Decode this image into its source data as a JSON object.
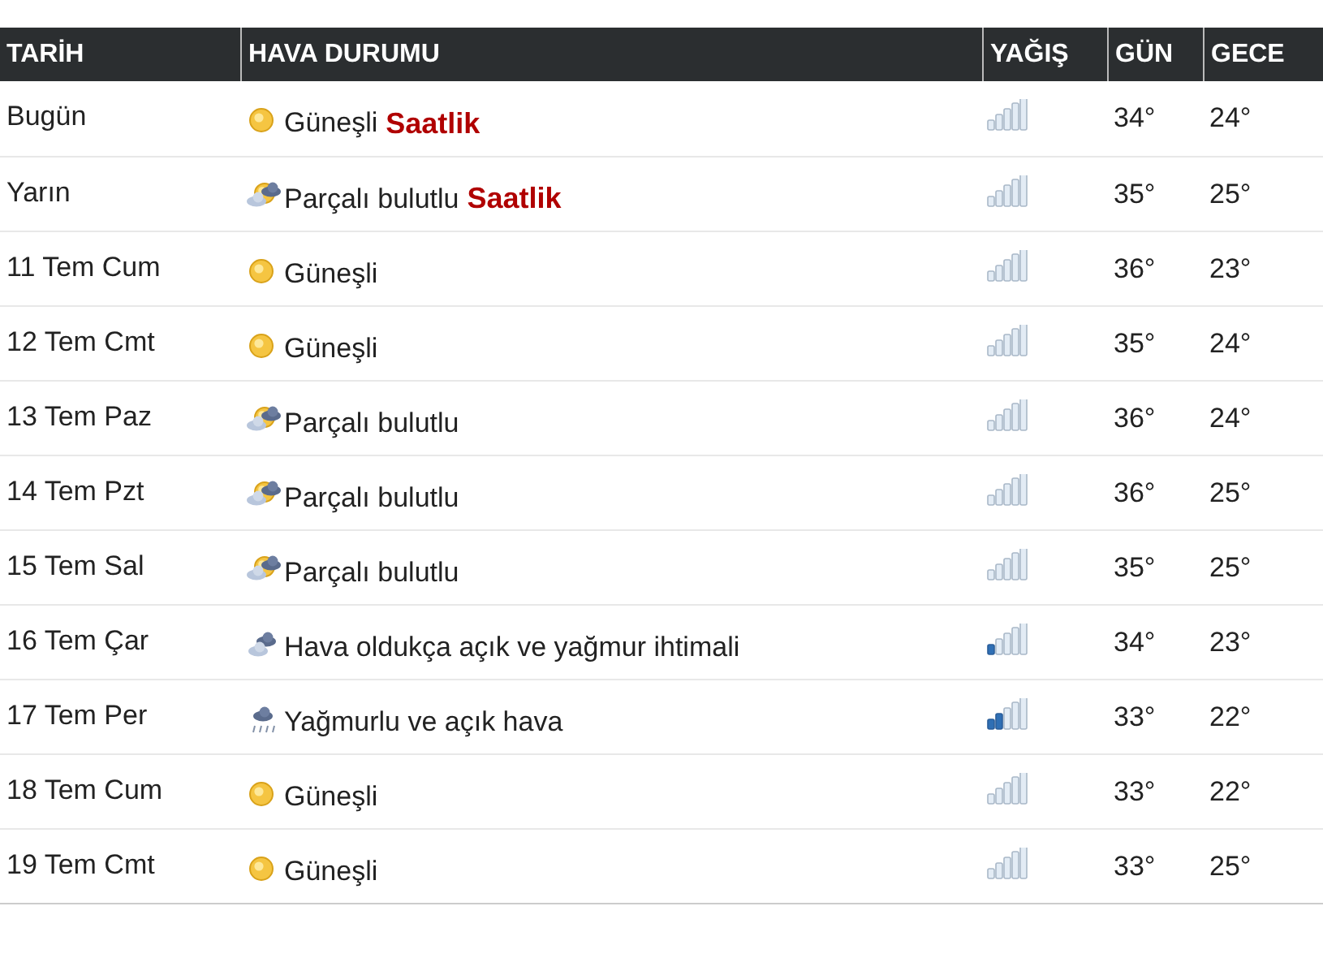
{
  "columns": [
    "TARİH",
    "HAVA DURUMU",
    "YAĞIŞ",
    "GÜN",
    "GECE"
  ],
  "rows": [
    {
      "date": "Bugün",
      "kind": "sunny",
      "condition": "Güneşli",
      "link": "Saatlik",
      "rain": {
        "kind": "none"
      },
      "day": "34°",
      "night": "24°"
    },
    {
      "date": "Yarın",
      "kind": "partly",
      "condition": "Parçalı bulutlu",
      "link": "Saatlik",
      "rain": {
        "kind": "none"
      },
      "day": "35°",
      "night": "25°"
    },
    {
      "date": "11 Tem Cum",
      "kind": "sunny",
      "condition": "Güneşli",
      "rain": {
        "kind": "none"
      },
      "day": "36°",
      "night": "23°"
    },
    {
      "date": "12 Tem Cmt",
      "kind": "sunny",
      "condition": "Güneşli",
      "rain": {
        "kind": "none"
      },
      "day": "35°",
      "night": "24°"
    },
    {
      "date": "13 Tem Paz",
      "kind": "partly",
      "condition": "Parçalı bulutlu",
      "rain": {
        "kind": "none"
      },
      "day": "36°",
      "night": "24°"
    },
    {
      "date": "14 Tem Pzt",
      "kind": "partly",
      "condition": "Parçalı bulutlu",
      "rain": {
        "kind": "none"
      },
      "day": "36°",
      "night": "25°"
    },
    {
      "date": "15 Tem Sal",
      "kind": "partly",
      "condition": "Parçalı bulutlu",
      "rain": {
        "kind": "none"
      },
      "day": "35°",
      "night": "25°"
    },
    {
      "date": "16 Tem Çar",
      "kind": "cloudy",
      "condition": "Hava oldukça açık ve yağmur ihtimali",
      "rain": {
        "kind": "light"
      },
      "day": "34°",
      "night": "23°"
    },
    {
      "date": "17 Tem Per",
      "kind": "rain",
      "condition": "Yağmurlu ve açık hava",
      "rain": {
        "kind": "moderate"
      },
      "day": "33°",
      "night": "22°"
    },
    {
      "date": "18 Tem Cum",
      "kind": "sunny",
      "condition": "Güneşli",
      "rain": {
        "kind": "none"
      },
      "day": "33°",
      "night": "22°"
    },
    {
      "date": "19 Tem Cmt",
      "kind": "sunny",
      "condition": "Güneşli",
      "rain": {
        "kind": "none"
      },
      "day": "33°",
      "night": "25°"
    }
  ]
}
